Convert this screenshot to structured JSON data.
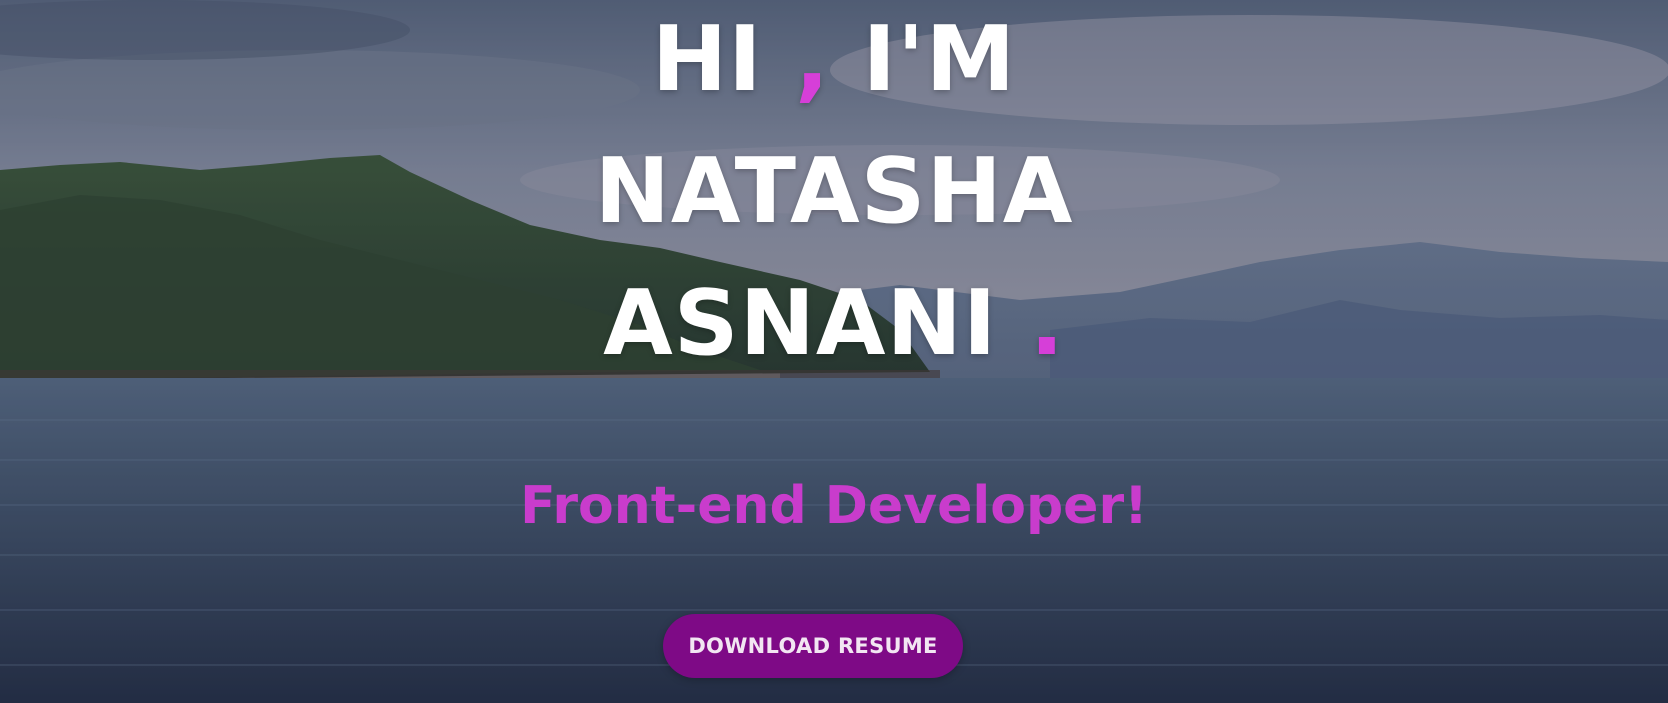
{
  "hero": {
    "greeting_hi": "HI",
    "greeting_comma": ",",
    "greeting_im": "I'M",
    "first_name": "NATASHA",
    "last_name": "ASNANI",
    "name_period": ".",
    "subtitle": "Front-end Developer!",
    "resume_button_label": "DOWNLOAD RESUME"
  },
  "colors": {
    "accent": "#d63fd8",
    "subtitle": "#c93ccc",
    "button_bg": "#7e0a86",
    "heading": "#ffffff"
  }
}
